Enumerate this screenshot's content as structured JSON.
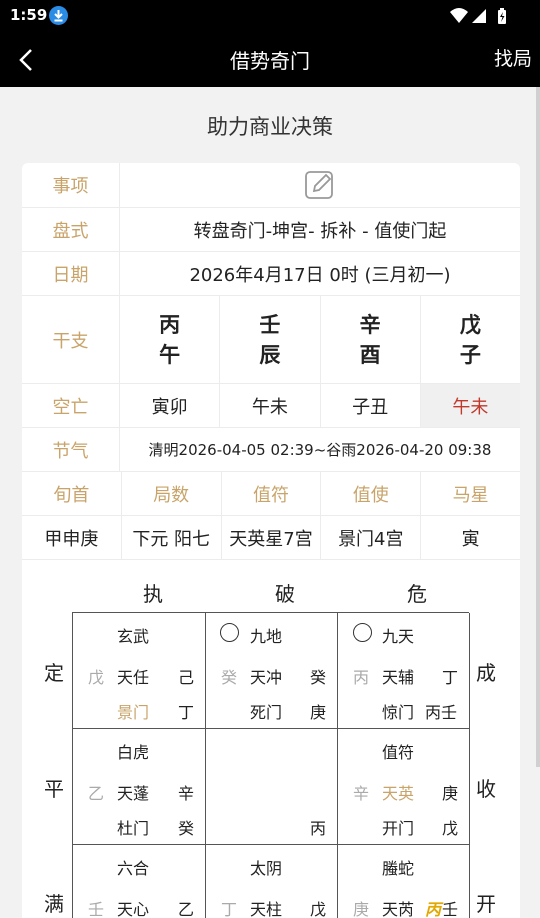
{
  "status": {
    "time": "1:59"
  },
  "appbar": {
    "title": "借势奇门",
    "right": "找局"
  },
  "subtitle": "助力商业决策",
  "rows": {
    "shixiang": {
      "label": "事项"
    },
    "panshi": {
      "label": "盘式",
      "value": "转盘奇门-坤宫- 拆补 - 值使门起"
    },
    "riqi": {
      "label": "日期",
      "value": "2026年4月17日 0时 (三月初一)"
    },
    "ganzhi": {
      "label": "干支",
      "cols": [
        {
          "top": "丙",
          "bottom": "午"
        },
        {
          "top": "壬",
          "bottom": "辰"
        },
        {
          "top": "辛",
          "bottom": "酉"
        },
        {
          "top": "戊",
          "bottom": "子"
        }
      ]
    },
    "kongwang": {
      "label": "空亡",
      "cols": [
        "寅卯",
        "午未",
        "子丑",
        "午未"
      ]
    },
    "jieqi": {
      "label": "节气",
      "value": "清明2026-04-05 02:39~谷雨2026-04-20 09:38"
    },
    "headers": [
      "旬首",
      "局数",
      "值符",
      "值使",
      "马星"
    ],
    "values": [
      "甲申庚",
      "下元 阳七",
      "天英星7宫",
      "景门4宫",
      "寅"
    ]
  },
  "grid": {
    "top_labels": [
      "执",
      "破",
      "危"
    ],
    "left_labels": [
      "定",
      "平",
      "满"
    ],
    "right_labels": [
      "成",
      "收",
      "开"
    ],
    "p1": {
      "god": "玄武",
      "a": "戊",
      "star": "天任",
      "b": "己",
      "door": "景门",
      "c": "丁"
    },
    "p2": {
      "god": "九地",
      "a": "癸",
      "star": "天冲",
      "b": "癸",
      "door": "死门",
      "c": "庚"
    },
    "p3": {
      "god": "九天",
      "a": "丙",
      "star": "天辅",
      "b": "丁",
      "door": "惊门",
      "c": "丙壬"
    },
    "p4": {
      "god": "白虎",
      "a": "乙",
      "star": "天蓬",
      "b": "辛",
      "door": "杜门",
      "c": "癸"
    },
    "p5": {
      "c": "丙"
    },
    "p6": {
      "god": "值符",
      "a": "辛",
      "star": "天英",
      "b": "庚",
      "door": "开门",
      "c": "戊"
    },
    "p7": {
      "god": "六合",
      "a": "壬",
      "star": "天心",
      "b": "乙"
    },
    "p8": {
      "god": "太阴",
      "a": "丁",
      "star": "天柱",
      "b": "戊"
    },
    "p9": {
      "god": "螣蛇",
      "a": "庚",
      "star": "天芮",
      "b1": "丙",
      "b2": "壬"
    }
  }
}
